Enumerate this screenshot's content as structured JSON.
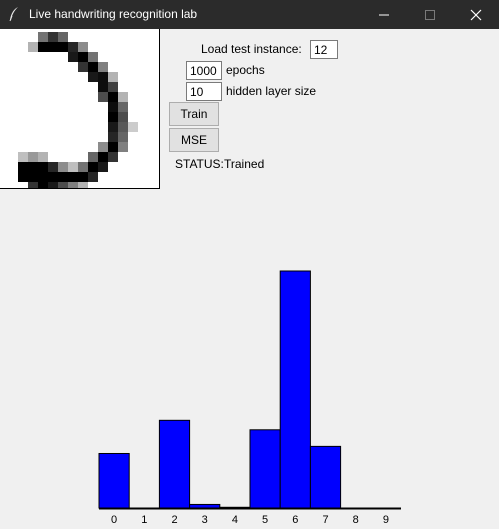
{
  "window": {
    "title": "Live handwriting recognition lab",
    "minimize_icon": "minimize-icon",
    "maximize_icon": "maximize-icon",
    "close_icon": "close-icon",
    "app_icon": "feather-icon"
  },
  "controls": {
    "load_label": "Load test instance:",
    "load_value": "12",
    "epochs_value": "1000",
    "epochs_label": "epochs",
    "hidden_value": "10",
    "hidden_label": "hidden layer size",
    "train_label": "Train",
    "mse_label": "MSE",
    "status_label": "STATUS:",
    "status_value": "Trained"
  },
  "colors": {
    "bar": "#0000ff",
    "titlebar": "#2b2b2b",
    "background": "#f0f0f0"
  },
  "chart_data": {
    "type": "bar",
    "categories": [
      "0",
      "1",
      "2",
      "3",
      "4",
      "5",
      "6",
      "7",
      "8",
      "9"
    ],
    "values": [
      0.23,
      0.0,
      0.37,
      0.015,
      0.003,
      0.33,
      1.0,
      0.26,
      0.0,
      0.0
    ],
    "title": "",
    "xlabel": "",
    "ylabel": "",
    "ylim": [
      0,
      1
    ],
    "grid": false,
    "legend": "none"
  }
}
